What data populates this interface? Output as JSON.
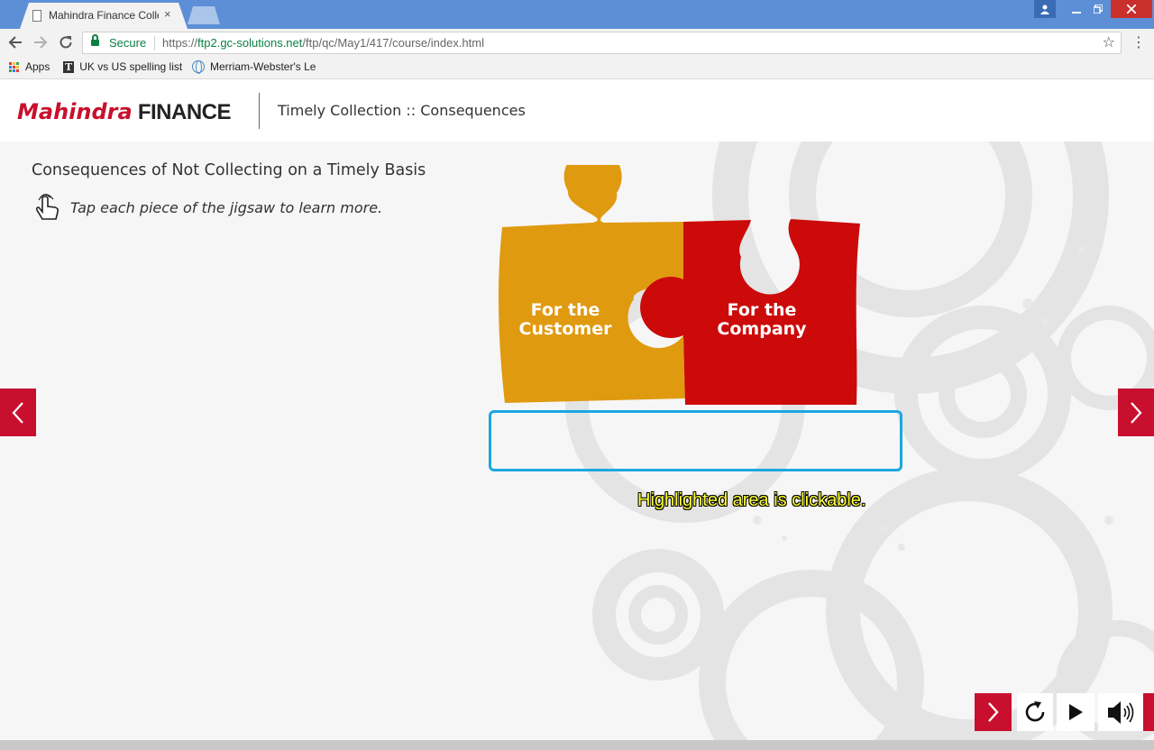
{
  "browser": {
    "tab_title": "Mahindra Finance Collect",
    "tab_close": "×",
    "secure_label": "Secure",
    "url_scheme": "https://",
    "url_host": "ftp2.gc-solutions.net",
    "url_path": "/ftp/qc/May1/417/course/index.html",
    "bookmarks": [
      {
        "label": "Apps",
        "icon": "apps-grid-icon"
      },
      {
        "label": "UK vs US spelling list",
        "icon": "t-icon"
      },
      {
        "label": "Merriam-Webster's Le",
        "icon": "globe-icon"
      }
    ]
  },
  "header": {
    "brand_part1": "Mahindra",
    "brand_part2": " FINANCE",
    "title": "Timely Collection :: Consequences"
  },
  "slide": {
    "title": "Consequences of Not Collecting on a Timely Basis",
    "instruction": "Tap each piece of the jigsaw to learn more.",
    "pieces": [
      {
        "line1": "For the",
        "line2": "Customer",
        "color": "#e09a10"
      },
      {
        "line1": "For the",
        "line2": "Company",
        "color": "#cc0a0a"
      }
    ],
    "hint": "Highlighted area is clickable."
  },
  "colors": {
    "accent": "#c8102e",
    "hotspot_border": "#1ba7e0",
    "hint_text": "#ffff33"
  }
}
